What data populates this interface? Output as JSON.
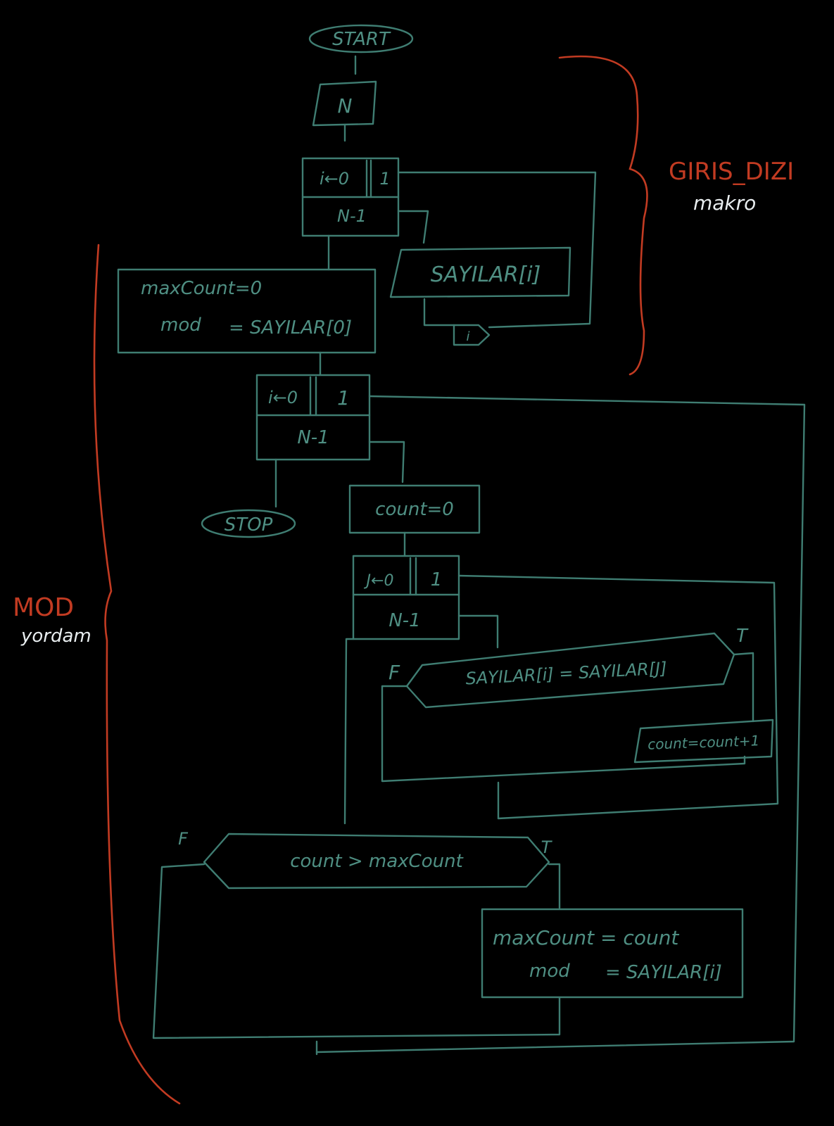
{
  "terminals": {
    "start": "START",
    "stop": "STOP"
  },
  "input_n": "N",
  "loop_i_input": {
    "init": "i←0",
    "step": "1",
    "limit": "N-1"
  },
  "input_array": "SAYILAR[i]",
  "connector": "i",
  "init_block": {
    "line1": "maxCount=0",
    "line2_left": "mod",
    "line2_right": "= SAYILAR[0]"
  },
  "loop_i_outer": {
    "init": "i←0",
    "step": "1",
    "limit": "N-1"
  },
  "count_init": "count=0",
  "loop_j": {
    "init": "J←0",
    "step": "1",
    "limit": "N-1"
  },
  "decision_inner": {
    "condition": "SAYILAR[i] = SAYILAR[J]",
    "false_label": "F",
    "true_label": "T"
  },
  "count_increment": "count=count+1",
  "decision_outer": {
    "condition": "count > maxCount",
    "false_label": "F",
    "true_label": "T"
  },
  "update_block": {
    "line1": "maxCount = count",
    "line2_left": "mod",
    "line2_right": "= SAYILAR[i]"
  },
  "annotations": {
    "top_title": "GIRIS_DIZI",
    "top_subtitle": "makro",
    "left_title": "MOD",
    "left_subtitle": "yordam"
  },
  "colors": {
    "background": "#000000",
    "flow": "#3f7d72",
    "text": "#4f8f83",
    "annotation_red": "#c23b22",
    "annotation_white": "#e9eef0"
  }
}
